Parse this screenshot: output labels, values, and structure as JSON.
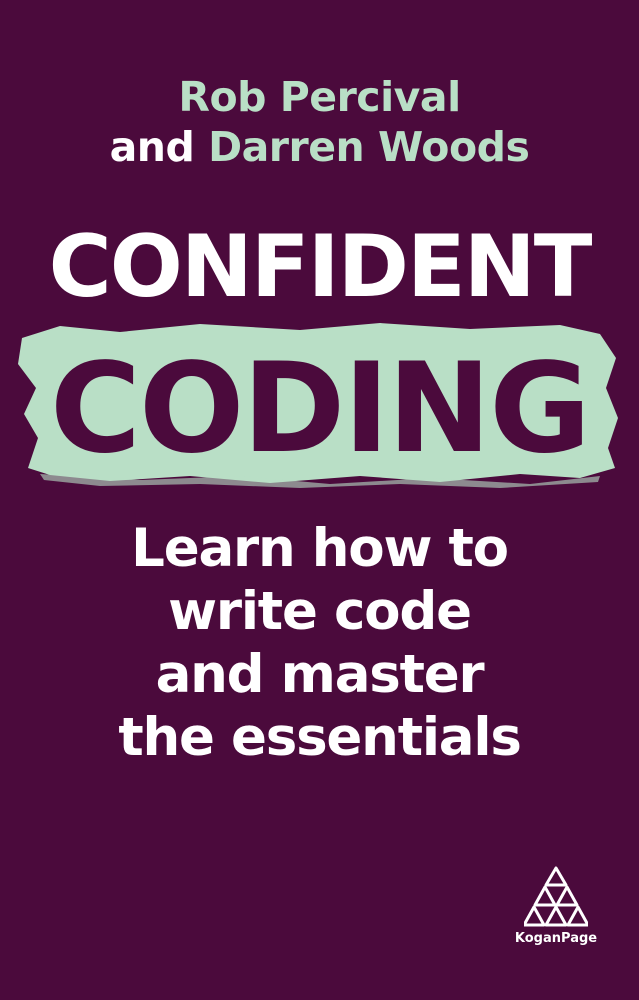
{
  "cover": {
    "authors": {
      "line1_name": "Rob Percival",
      "line2_prefix": "and",
      "line2_name": "Darren Woods"
    },
    "title": {
      "line1": "CONFIDENT",
      "line2": "CODING"
    },
    "subtitle": {
      "lines": [
        "Learn how to",
        "write code",
        "and master",
        "the essentials"
      ]
    },
    "publisher": {
      "name": "KoganPage",
      "logo_icon": "kogan-page-triangle-logo"
    },
    "colors": {
      "background": "#4b0a3c",
      "accent_mint": "#b9dfc6",
      "text": "#ffffff"
    }
  }
}
